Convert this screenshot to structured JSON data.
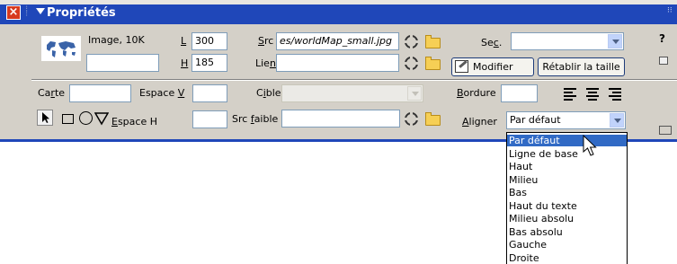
{
  "colors": {
    "titlebar": "#1f47b9",
    "panel": "#d4d0c8",
    "selection": "#316ac5"
  },
  "titlebar": {
    "title": "Propriétés",
    "close_icon": "close-icon",
    "collapse_icon": "triangle-down-icon"
  },
  "image": {
    "thumbnail_icon": "world-map-thumbnail",
    "info": "Image, 10K",
    "name_value": ""
  },
  "fields": {
    "width_label": "L",
    "width_value": "300",
    "height_label": "H",
    "height_value": "185",
    "src_label": "Src",
    "src_value": "es/worldMap_small.jpg",
    "link_label": "Lien",
    "link_value": "",
    "sec_label": "Sec.",
    "sec_value": "",
    "map_label": "Carte",
    "map_value": "",
    "vspace_label": "Espace V",
    "vspace_value": "",
    "hspace_label": "Espace H",
    "hspace_value": "",
    "target_label": "Cible",
    "target_value": "",
    "lowsrc_label": "Src faible",
    "lowsrc_value": "",
    "border_label": "Bordure",
    "border_value": "",
    "align_label": "Aligner",
    "align_value": "Par défaut"
  },
  "buttons": {
    "edit": "Modifier",
    "reset_size": "Rétablir la taille"
  },
  "align_options": [
    "Par défaut",
    "Ligne de base",
    "Haut",
    "Milieu",
    "Bas",
    "Haut du texte",
    "Milieu absolu",
    "Bas absolu",
    "Gauche",
    "Droite"
  ],
  "align_selected": "Par défaut",
  "right_icons": {
    "help": "?"
  }
}
